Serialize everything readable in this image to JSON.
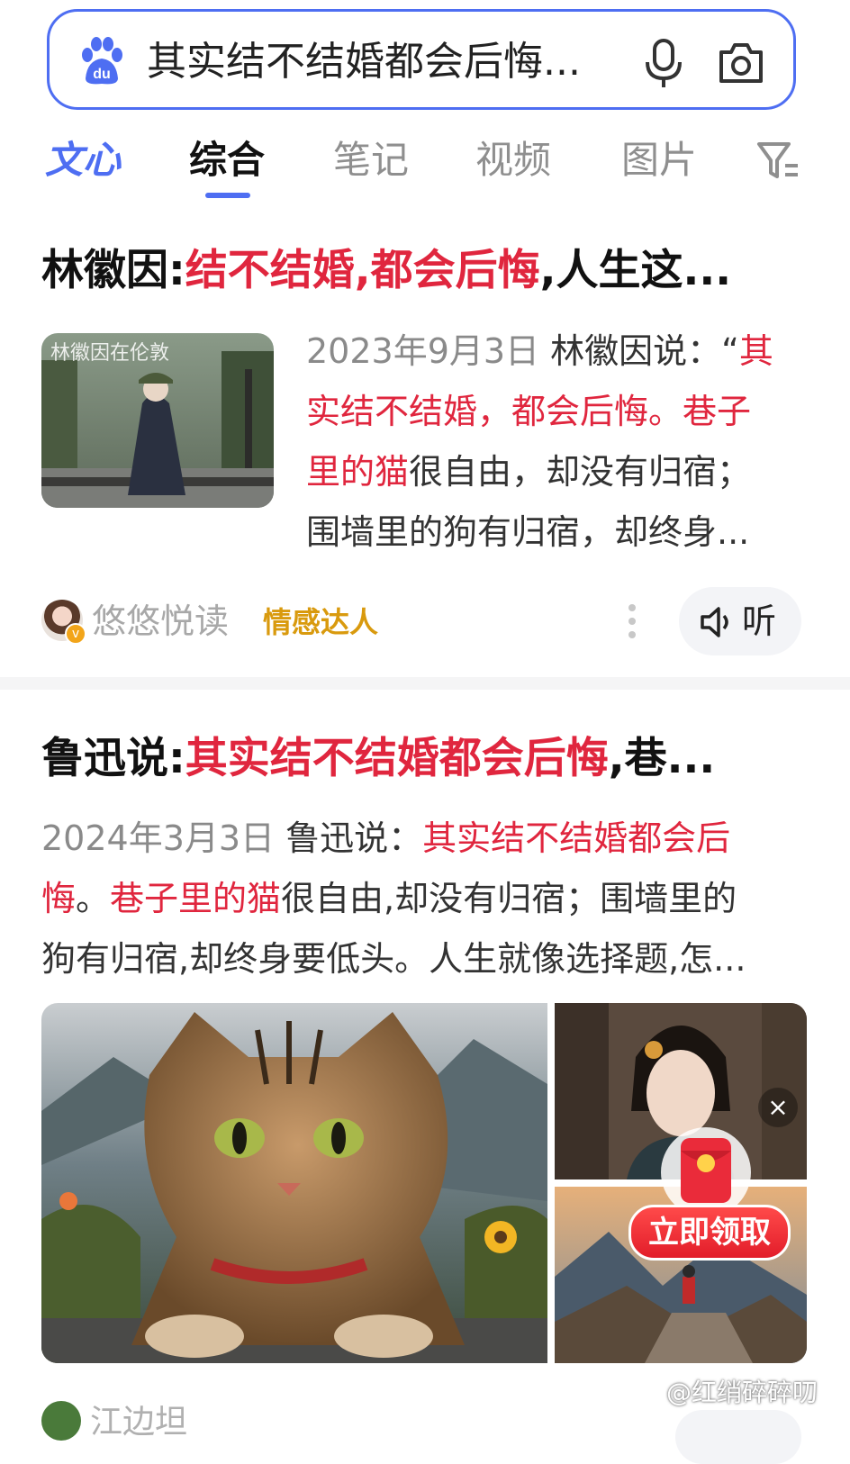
{
  "search": {
    "query": "其实结不结婚都会后悔...",
    "logo_icon": "baidu-paw-logo",
    "voice_icon": "microphone-icon",
    "image_search_icon": "camera-icon"
  },
  "tabs": {
    "wenxin": "文心",
    "items": [
      "综合",
      "笔记",
      "视频",
      "图片"
    ],
    "active": "综合",
    "filter_icon": "filter-icon"
  },
  "results": [
    {
      "title_prefix": "林徽因:",
      "title_highlight": "结不结婚,都会后悔",
      "title_suffix": ",人生这...",
      "thumbnail_caption": "林徽因在伦敦",
      "date": "2023年9月3日",
      "snippet_lines": [
        {
          "plain": "林徽因说：“",
          "red": "其"
        },
        {
          "red": "实结不结婚，都会后悔。巷子"
        },
        {
          "red": "里的猫",
          "plain": "很自由，却没有归宿；"
        },
        {
          "plain": "围墙里的狗有归宿，却终身..."
        }
      ],
      "author": "悠悠悦读",
      "author_badge": "情感达人",
      "more_icon": "more-vertical-icon",
      "listen_label": "听",
      "listen_icon": "speaker-icon"
    },
    {
      "title_prefix": "鲁迅说:",
      "title_highlight": "其实结不结婚都会后悔",
      "title_suffix": ",巷...",
      "date": "2024年3月3日",
      "snippet_lines": [
        {
          "plain": "鲁迅说：",
          "red": "其实结不结婚都会后"
        },
        {
          "red_a": "悔",
          "plain_a": "。",
          "red_b": "巷子里的猫",
          "plain_b": "很自由,却没有归宿；围墙里的"
        },
        {
          "plain": "狗有归宿,却终身要低头。人生就像选择题,怎..."
        }
      ],
      "close_label": "×",
      "claim_label": "立即领取",
      "redpacket_icon": "red-envelope-icon"
    }
  ],
  "bottom": {
    "author_partial": "江边坦",
    "watermark": "@红绡碎碎叨"
  },
  "colors": {
    "accent": "#4e6ef2",
    "highlight": "#e0263e",
    "badge": "#d99a0e"
  }
}
